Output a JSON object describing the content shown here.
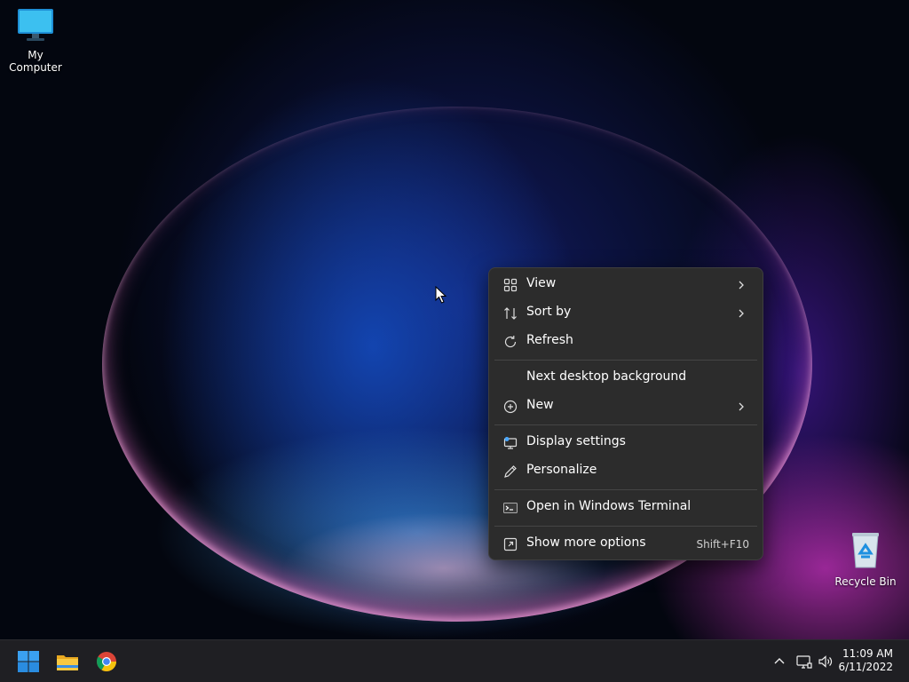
{
  "desktop": {
    "icons": [
      {
        "label": "My Computer",
        "icon": "monitor-icon"
      },
      {
        "label": "Recycle Bin",
        "icon": "recycle-bin-icon"
      }
    ]
  },
  "context_menu": {
    "items": [
      {
        "label": "View",
        "icon": "grid-icon",
        "submenu": true
      },
      {
        "label": "Sort by",
        "icon": "sort-arrows-icon",
        "submenu": true
      },
      {
        "label": "Refresh",
        "icon": "refresh-icon",
        "submenu": false
      },
      {
        "label": "Next desktop background",
        "icon": "",
        "submenu": false
      },
      {
        "label": "New",
        "icon": "plus-circle-icon",
        "submenu": true
      },
      {
        "label": "Display settings",
        "icon": "display-settings-icon",
        "submenu": false
      },
      {
        "label": "Personalize",
        "icon": "pen-icon",
        "submenu": false
      },
      {
        "label": "Open in Windows Terminal",
        "icon": "terminal-icon",
        "submenu": false
      },
      {
        "label": "Show more options",
        "icon": "more-options-icon",
        "shortcut": "Shift+F10"
      }
    ]
  },
  "taskbar": {
    "pinned": [
      "start-icon",
      "file-explorer-icon",
      "chrome-icon"
    ],
    "tray": [
      "chevron-up-icon",
      "network-icon",
      "volume-icon"
    ],
    "time": "11:09 AM",
    "date": "6/11/2022"
  },
  "colors": {
    "menu_bg": "#2c2c2c",
    "taskbar_bg": "#1f1f23",
    "accent": "#0078d4"
  }
}
